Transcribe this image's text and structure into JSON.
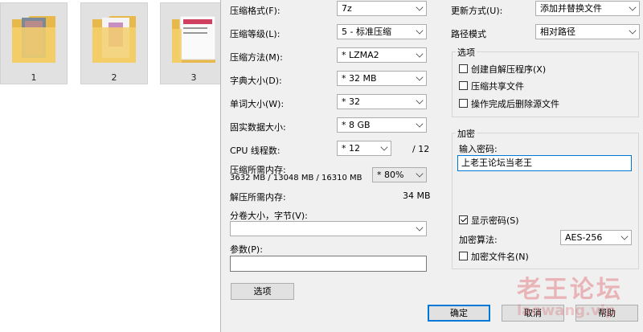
{
  "thumbnails": [
    {
      "caption": "1"
    },
    {
      "caption": "2"
    },
    {
      "caption": "3"
    }
  ],
  "left": {
    "format_label": "压缩格式(F):",
    "format_value": "7z",
    "level_label": "压缩等级(L):",
    "level_value": "5 - 标准压缩",
    "method_label": "压缩方法(M):",
    "method_value": "* LZMA2",
    "dict_label": "字典大小(D):",
    "dict_value": "* 32 MB",
    "word_label": "单词大小(W):",
    "word_value": "* 32",
    "solid_label": "固实数据大小:",
    "solid_value": "* 8 GB",
    "cpu_label": "CPU 线程数:",
    "cpu_value": "* 12",
    "cpu_total": "/ 12",
    "mem_label": "压缩所需内存:",
    "mem_values": "3632 MB / 13048 MB / 16310 MB",
    "mem_percent": "* 80%",
    "decomp_label": "解压所需内存:",
    "decomp_value": "34 MB",
    "split_label": "分卷大小，字节(V):",
    "split_value": "",
    "params_label": "参数(P):",
    "params_value": "",
    "options_button": "选项"
  },
  "right": {
    "update_label": "更新方式(U):",
    "update_value": "添加并替换文件",
    "path_label": "路径模式",
    "path_value": "相对路径",
    "options_group": "选项",
    "opt_sfx": "创建自解压程序(X)",
    "opt_shared": "压缩共享文件",
    "opt_delete": "操作完成后删除源文件",
    "encrypt_group": "加密",
    "password_label": "输入密码:",
    "password_value": "上老王论坛当老王",
    "show_password": "显示密码(S)",
    "enc_method_label": "加密算法:",
    "enc_method_value": "AES-256",
    "enc_names": "加密文件名(N)"
  },
  "buttons": {
    "ok": "确定",
    "cancel": "取消",
    "help": "帮助"
  },
  "watermark": {
    "text": "老王论坛",
    "url": "laowang.vip"
  },
  "colors": {
    "dialog_bg": "#f0f0f0",
    "accent": "#0078d7",
    "watermark": "#dc4650"
  }
}
